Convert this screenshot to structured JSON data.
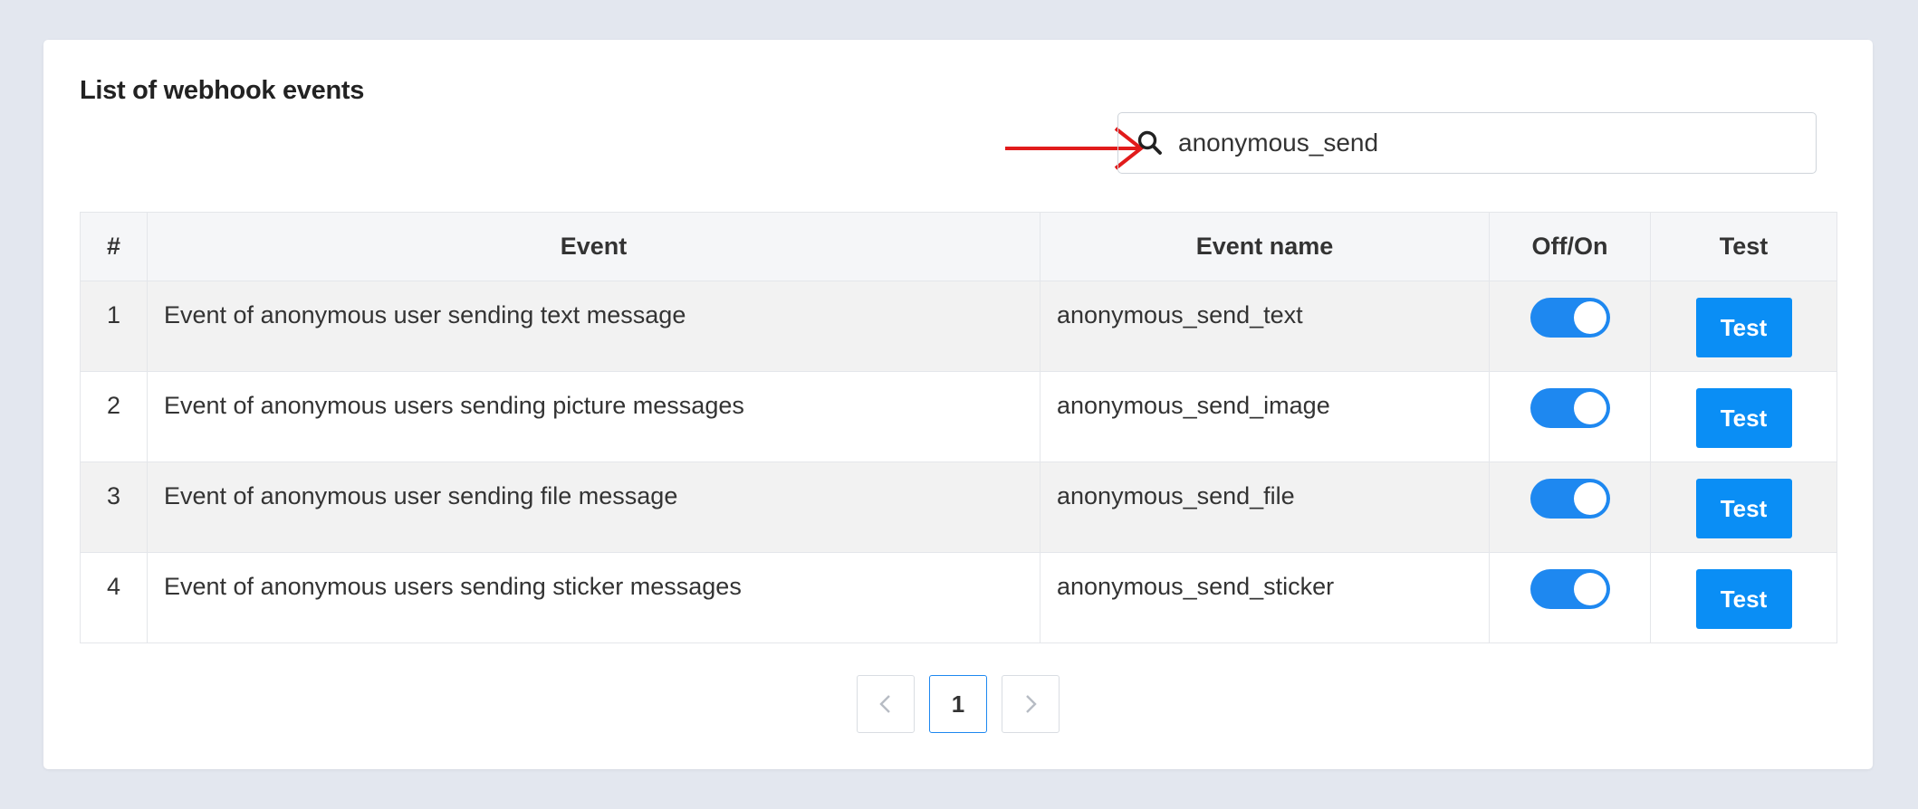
{
  "title": "List of webhook events",
  "search": {
    "value": "anonymous_send",
    "icon": "search-icon"
  },
  "annotation": {
    "color": "#e11b1b"
  },
  "colors": {
    "accent": "#0a8ef5",
    "toggle": "#1e88f0"
  },
  "table": {
    "headers": [
      "#",
      "Event",
      "Event name",
      "Off/On",
      "Test"
    ],
    "rows": [
      {
        "num": "1",
        "event": "Event of anonymous user sending text message",
        "name": "anonymous_send_text",
        "enabled": true,
        "test_label": "Test"
      },
      {
        "num": "2",
        "event": "Event of anonymous users sending picture messages",
        "name": "anonymous_send_image",
        "enabled": true,
        "test_label": "Test"
      },
      {
        "num": "3",
        "event": "Event of anonymous user sending file message",
        "name": "anonymous_send_file",
        "enabled": true,
        "test_label": "Test"
      },
      {
        "num": "4",
        "event": "Event of anonymous users sending sticker messages",
        "name": "anonymous_send_sticker",
        "enabled": true,
        "test_label": "Test"
      }
    ]
  },
  "pagination": {
    "current": "1"
  }
}
